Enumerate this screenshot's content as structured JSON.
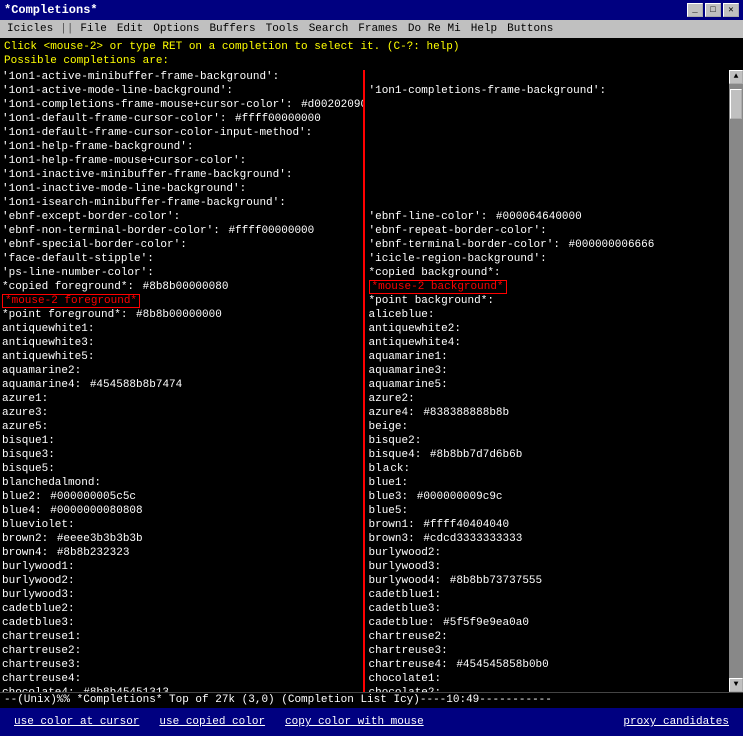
{
  "window": {
    "title": "*Completions*",
    "controls": [
      "_",
      "□",
      "✕"
    ]
  },
  "menubar": {
    "items": [
      "Icicles",
      "||",
      "File",
      "Edit",
      "Options",
      "Buffers",
      "Tools",
      "Search",
      "Frames",
      "Do Re Mi",
      "Help",
      "Buttons"
    ]
  },
  "info_line": {
    "line1": "Click <mouse-2> or type RET on a completion to select it.  (C-?: help)",
    "line2": "Possible completions are:"
  },
  "status_bar": "--(Unix)%%  *Completions*   Top of 27k  (3,0)          (Completion List Icy)----10:49-----------",
  "action_bar": {
    "items": [
      "use color at cursor",
      "use copied color",
      "copy color with mouse",
      "proxy candidates"
    ]
  }
}
